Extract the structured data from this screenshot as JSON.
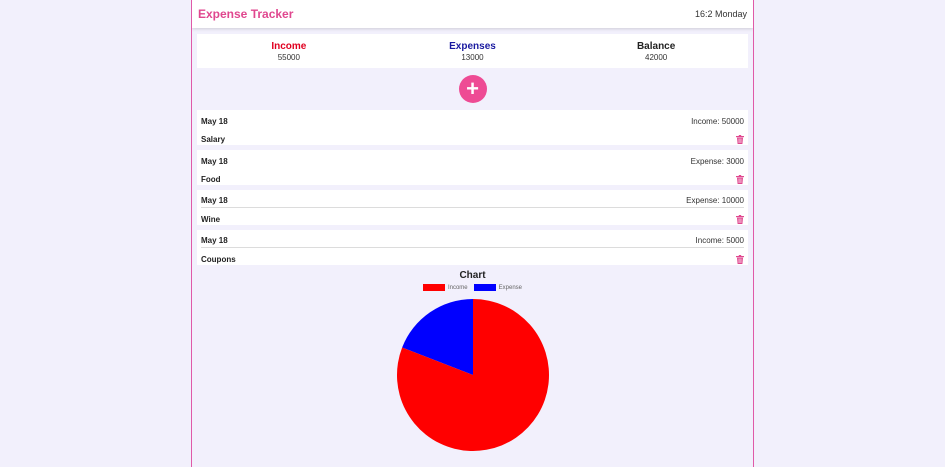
{
  "header": {
    "title": "Expense Tracker",
    "clock": "16:2 Monday"
  },
  "summary": {
    "income_label": "Income",
    "income_value": "55000",
    "expense_label": "Expenses",
    "expense_value": "13000",
    "balance_label": "Balance",
    "balance_value": "42000"
  },
  "add_button": {
    "symbol": "+"
  },
  "transactions": [
    {
      "date": "May 18",
      "amount": "Income: 50000",
      "name": "Salary"
    },
    {
      "date": "May 18",
      "amount": "Expense: 3000",
      "name": "Food"
    },
    {
      "date": "May 18",
      "amount": "Expense: 10000",
      "name": "Wine"
    },
    {
      "date": "May 18",
      "amount": "Income: 5000",
      "name": "Coupons"
    }
  ],
  "colors": {
    "accent": "#ee4b94",
    "income": "#ff0000",
    "expense": "#0000ff",
    "trash": "#e0478f"
  },
  "chart_data": {
    "type": "pie",
    "title": "Chart",
    "categories": [
      "Income",
      "Expense"
    ],
    "values": [
      55000,
      13000
    ],
    "colors": [
      "#ff0000",
      "#0000ff"
    ],
    "legend_position": "top"
  }
}
